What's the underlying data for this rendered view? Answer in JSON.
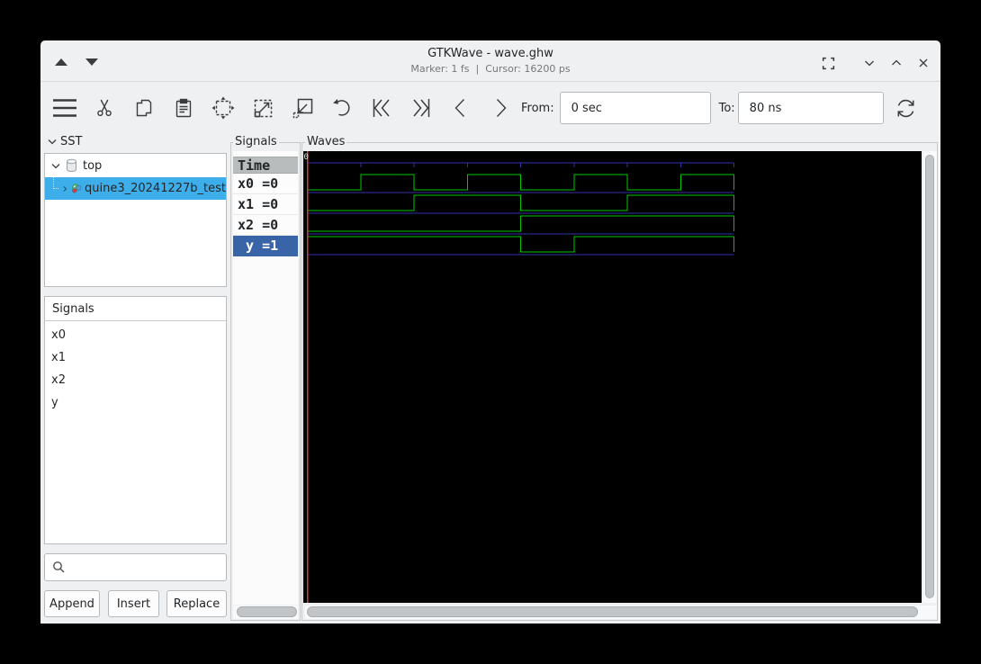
{
  "window": {
    "title": "GTKWave - wave.ghw",
    "subtitle": "Marker: 1 fs  |  Cursor: 16200 ps"
  },
  "toolbar": {
    "from_label": "From:",
    "from_value": "0 sec",
    "to_label": "To:",
    "to_value": "80 ns"
  },
  "sidebar": {
    "sst_label": "SST",
    "tree": [
      {
        "label": "top"
      },
      {
        "label": "quine3_20241227b_test",
        "selected": true
      }
    ],
    "signals_header": "Signals",
    "signals": [
      "x0",
      "x1",
      "x2",
      "y"
    ],
    "search_value": "",
    "buttons": [
      "Append",
      "Insert",
      "Replace"
    ]
  },
  "signals_panel": {
    "frame_label": "Signals",
    "header": "Time",
    "rows": [
      {
        "text": "x0 =0",
        "selected": false
      },
      {
        "text": "x1 =0",
        "selected": false
      },
      {
        "text": "x2 =0",
        "selected": false
      },
      {
        "text": " y =1",
        "selected": true
      }
    ]
  },
  "waves_panel": {
    "frame_label": "Waves",
    "origin_label": "0",
    "time_end_ns": 80,
    "tick_ns": 10,
    "colors": {
      "signal": "#00c800",
      "grid": "#3232aa",
      "marker": "#c94534",
      "bg": "#000000"
    },
    "signals": [
      {
        "name": "x0",
        "initial": 0,
        "changes": [
          [
            10,
            1
          ],
          [
            20,
            0
          ],
          [
            30,
            1
          ],
          [
            40,
            0
          ],
          [
            50,
            1
          ],
          [
            60,
            0
          ],
          [
            70,
            1
          ]
        ]
      },
      {
        "name": "x1",
        "initial": 0,
        "changes": [
          [
            20,
            1
          ],
          [
            40,
            0
          ],
          [
            60,
            1
          ]
        ]
      },
      {
        "name": "x2",
        "initial": 0,
        "changes": [
          [
            40,
            1
          ]
        ]
      },
      {
        "name": "y",
        "initial": 1,
        "changes": [
          [
            40,
            0
          ],
          [
            50,
            1
          ]
        ]
      }
    ]
  }
}
